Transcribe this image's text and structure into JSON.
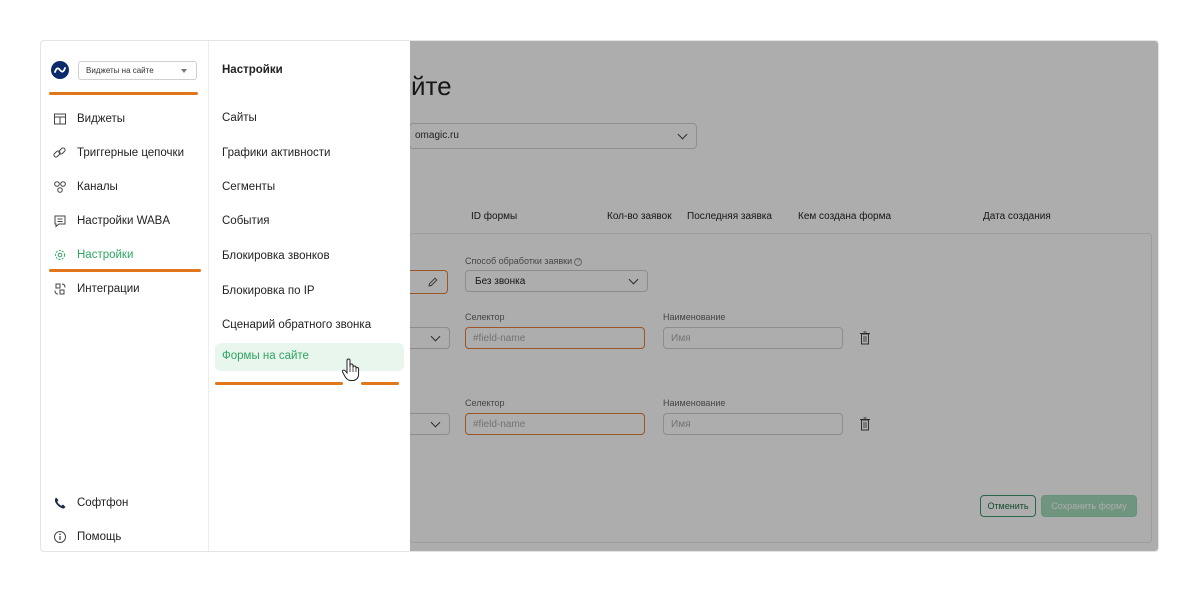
{
  "sidebar": {
    "widget_selector": "Виджеты на сайте",
    "items": [
      {
        "label": "Виджеты",
        "icon": "widgets-icon"
      },
      {
        "label": "Триггерные цепочки",
        "icon": "link-chain-icon"
      },
      {
        "label": "Каналы",
        "icon": "channels-icon"
      },
      {
        "label": "Настройки WABA",
        "icon": "chat-icon"
      },
      {
        "label": "Настройки",
        "icon": "gear-icon"
      },
      {
        "label": "Интеграции",
        "icon": "integrations-icon"
      }
    ],
    "bottom_items": [
      {
        "label": "Софтфон",
        "icon": "phone-icon"
      },
      {
        "label": "Помощь",
        "icon": "info-icon"
      }
    ],
    "active_item": "Настройки"
  },
  "submenu": {
    "title": "Настройки",
    "items": [
      "Сайты",
      "Графики активности",
      "Сегменты",
      "События",
      "Блокировка звонков",
      "Блокировка по IP",
      "Сценарий обратного звонка",
      "Формы на сайте"
    ],
    "active_item": "Формы на сайте"
  },
  "main": {
    "page_title_fragment": "йте",
    "site_select_value": "omagic.ru",
    "table_headers": [
      "ID формы",
      "Кол-во заявок",
      "Последняя заявка",
      "Кем создана форма",
      "Дата создания"
    ],
    "form": {
      "processing_label": "Способ обработки заявки",
      "processing_hint": "?",
      "processing_value": "Без звонка",
      "fields": [
        {
          "selector_label": "Селектор",
          "selector_placeholder": "#field-name",
          "name_label": "Наименование",
          "name_placeholder": "Имя"
        },
        {
          "selector_label": "Селектор",
          "selector_placeholder": "#field-name",
          "name_label": "Наименование",
          "name_placeholder": "Имя"
        }
      ],
      "cancel_label": "Отменить",
      "save_label": "Сохранить форму"
    }
  },
  "colors": {
    "accent_green": "#2fa463",
    "underline_orange": "#e2761b",
    "input_orange": "#e77d3a",
    "logo_navy": "#0a2a6b"
  }
}
